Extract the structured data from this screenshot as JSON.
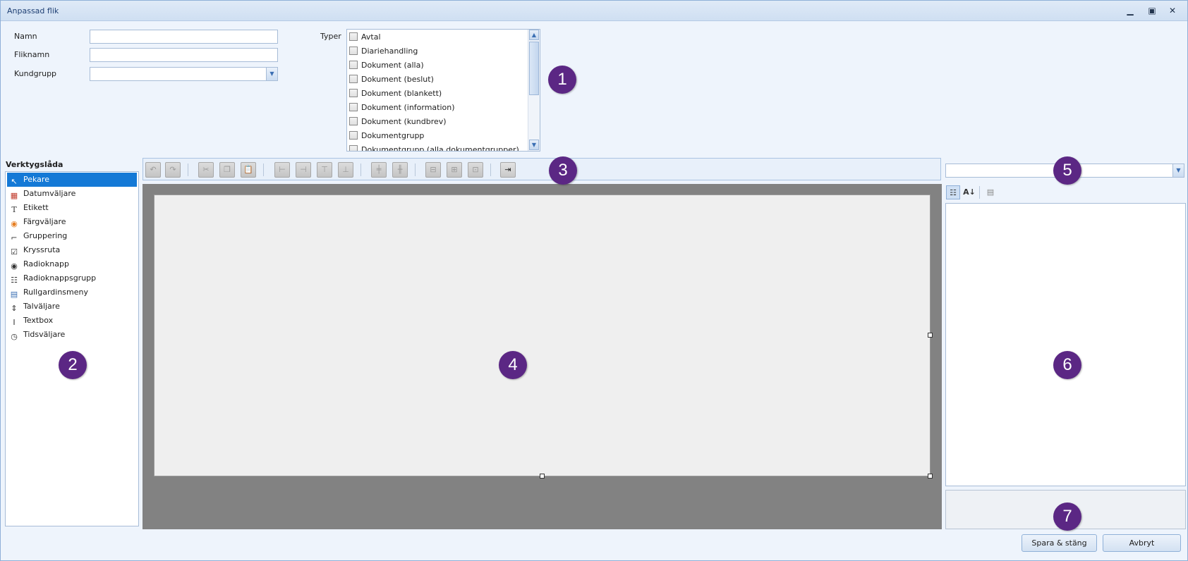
{
  "window": {
    "title": "Anpassad flik",
    "minimize_glyph": "▁",
    "maximize_glyph": "▣",
    "close_glyph": "✕"
  },
  "form": {
    "name_label": "Namn",
    "name_value": "",
    "tabname_label": "Fliknamn",
    "tabname_value": "",
    "customergroup_label": "Kundgrupp",
    "customergroup_value": ""
  },
  "types": {
    "label": "Typer",
    "items": [
      {
        "label": "Avtal",
        "checked": false
      },
      {
        "label": "Diariehandling",
        "checked": false
      },
      {
        "label": "Dokument (alla)",
        "checked": false
      },
      {
        "label": "Dokument (beslut)",
        "checked": false
      },
      {
        "label": "Dokument (blankett)",
        "checked": false
      },
      {
        "label": "Dokument (information)",
        "checked": false
      },
      {
        "label": "Dokument (kundbrev)",
        "checked": false
      },
      {
        "label": "Dokumentgrupp",
        "checked": false
      },
      {
        "label": "Dokumentgrupp (alla dokumentgrupper)",
        "checked": false
      }
    ]
  },
  "toolbox": {
    "header": "Verktygslåda",
    "items": [
      {
        "label": "Pekare",
        "icon": "pointer-icon",
        "glyph": "↖",
        "selected": true
      },
      {
        "label": "Datumväljare",
        "icon": "calendar-icon",
        "glyph": "▦",
        "selected": false
      },
      {
        "label": "Etikett",
        "icon": "label-icon",
        "glyph": "T",
        "selected": false
      },
      {
        "label": "Färgväljare",
        "icon": "color-wheel-icon",
        "glyph": "◉",
        "selected": false
      },
      {
        "label": "Gruppering",
        "icon": "groupbox-icon",
        "glyph": "⌐",
        "selected": false
      },
      {
        "label": "Kryssruta",
        "icon": "checkbox-icon",
        "glyph": "☑",
        "selected": false
      },
      {
        "label": "Radioknapp",
        "icon": "radio-icon",
        "glyph": "◉",
        "selected": false
      },
      {
        "label": "Radioknappsgrupp",
        "icon": "radio-group-icon",
        "glyph": "☷",
        "selected": false
      },
      {
        "label": "Rullgardinsmeny",
        "icon": "dropdown-icon",
        "glyph": "▤",
        "selected": false
      },
      {
        "label": "Talväljare",
        "icon": "numeric-icon",
        "glyph": "⇕",
        "selected": false
      },
      {
        "label": "Textbox",
        "icon": "textbox-icon",
        "glyph": "I",
        "selected": false
      },
      {
        "label": "Tidsväljare",
        "icon": "clock-icon",
        "glyph": "◷",
        "selected": false
      }
    ]
  },
  "toolbar": {
    "buttons": [
      {
        "icon": "undo-icon",
        "glyph": "↶"
      },
      {
        "icon": "redo-icon",
        "glyph": "↷"
      },
      {
        "icon": "cut-icon",
        "glyph": "✂"
      },
      {
        "icon": "copy-icon",
        "glyph": "❐"
      },
      {
        "icon": "paste-icon",
        "glyph": "📋"
      },
      {
        "icon": "align-left-icon",
        "glyph": "⊢"
      },
      {
        "icon": "align-right-icon",
        "glyph": "⊣"
      },
      {
        "icon": "align-top-icon",
        "glyph": "⊤"
      },
      {
        "icon": "align-bottom-icon",
        "glyph": "⊥"
      },
      {
        "icon": "center-horizontal-icon",
        "glyph": "╪"
      },
      {
        "icon": "center-vertical-icon",
        "glyph": "╫"
      },
      {
        "icon": "same-width-icon",
        "glyph": "⊟"
      },
      {
        "icon": "same-height-icon",
        "glyph": "⊞"
      },
      {
        "icon": "same-size-icon",
        "glyph": "⊡"
      },
      {
        "icon": "tab-order-icon",
        "glyph": "⇥"
      }
    ]
  },
  "properties": {
    "selector_value": "",
    "categorized_glyph": "☷",
    "alphabetical_glyph": "A↓",
    "pages_glyph": "▤"
  },
  "badges": [
    "1",
    "2",
    "3",
    "4",
    "5",
    "6",
    "7"
  ],
  "actions": {
    "save_close": "Spara & stäng",
    "cancel": "Avbryt"
  }
}
